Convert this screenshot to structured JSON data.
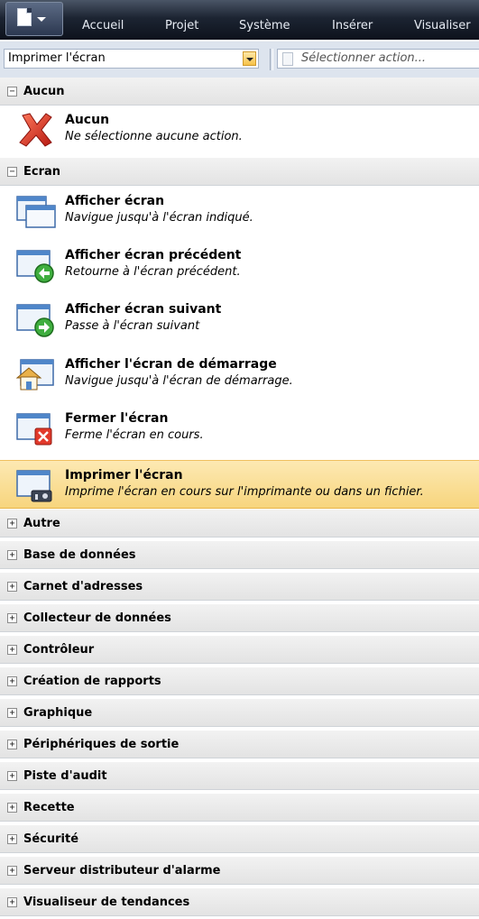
{
  "menubar": {
    "items": [
      "Accueil",
      "Projet",
      "Système",
      "Insérer",
      "Visualiser"
    ]
  },
  "toolbar": {
    "screen_combo_value": "Imprimer l'écran",
    "action_placeholder": "Sélectionner action..."
  },
  "groups": {
    "aucun": {
      "title": "Aucun",
      "toggle": "−",
      "items": [
        {
          "title": "Aucun",
          "desc": "Ne sélectionne aucune action.",
          "icon": "red-x-icon"
        }
      ]
    },
    "ecran": {
      "title": "Ecran",
      "toggle": "−",
      "items": [
        {
          "title": "Afficher écran",
          "desc": "Navigue jusqu'à l'écran indiqué.",
          "icon": "window-icon"
        },
        {
          "title": "Afficher écran précédent",
          "desc": "Retourne à l'écran précédent.",
          "icon": "window-back-icon"
        },
        {
          "title": "Afficher écran suivant",
          "desc": "Passe à l'écran suivant",
          "icon": "window-forward-icon"
        },
        {
          "title": "Afficher l'écran de démarrage",
          "desc": "Navigue jusqu'à l'écran de démarrage.",
          "icon": "window-home-icon"
        },
        {
          "title": "Fermer l'écran",
          "desc": "Ferme l'écran en cours.",
          "icon": "window-close-icon"
        },
        {
          "title": "Imprimer l'écran",
          "desc": "Imprime l'écran en cours sur l'imprimante ou dans un fichier.",
          "icon": "window-print-icon",
          "selected": true
        }
      ]
    },
    "collapsed": [
      {
        "title": "Autre",
        "toggle": "+"
      },
      {
        "title": "Base de données",
        "toggle": "+"
      },
      {
        "title": "Carnet d'adresses",
        "toggle": "+"
      },
      {
        "title": "Collecteur de données",
        "toggle": "+"
      },
      {
        "title": "Contrôleur",
        "toggle": "+"
      },
      {
        "title": "Création de rapports",
        "toggle": "+"
      },
      {
        "title": "Graphique",
        "toggle": "+"
      },
      {
        "title": "Périphériques de sortie",
        "toggle": "+"
      },
      {
        "title": "Piste d'audit",
        "toggle": "+"
      },
      {
        "title": "Recette",
        "toggle": "+"
      },
      {
        "title": "Sécurité",
        "toggle": "+"
      },
      {
        "title": "Serveur distributeur d'alarme",
        "toggle": "+"
      },
      {
        "title": "Visualiseur de tendances",
        "toggle": "+"
      }
    ]
  },
  "colors": {
    "selection": "#f7d57d",
    "menubar": "#1c2432",
    "group_header": "#e3e3e3"
  }
}
